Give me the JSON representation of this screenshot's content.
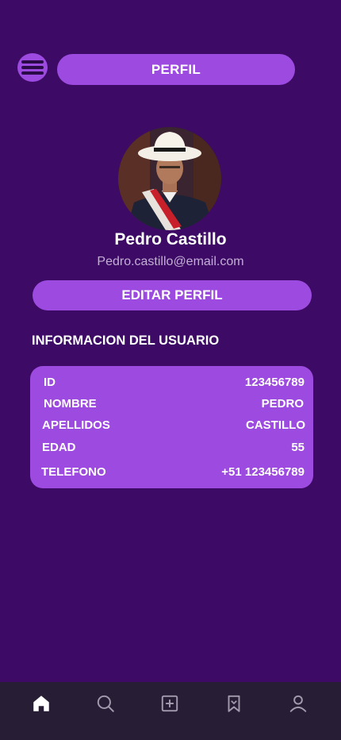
{
  "header": {
    "menu_icon": "hamburger-menu-icon",
    "title": "PERFIL"
  },
  "profile": {
    "name": "Pedro Castillo",
    "email": "Pedro.castillo@email.com",
    "edit_label": "EDITAR PERFIL"
  },
  "info": {
    "section_title": "INFORMACION DEL USUARIO",
    "rows": [
      {
        "label": "ID",
        "value": "123456789"
      },
      {
        "label": "NOMBRE",
        "value": "PEDRO"
      },
      {
        "label": "APELLIDOS",
        "value": "CASTILLO"
      },
      {
        "label": "EDAD",
        "value": "55"
      },
      {
        "label": "TELEFONO",
        "value": "+51 123456789"
      }
    ]
  },
  "nav": {
    "items": [
      {
        "icon": "home-icon",
        "active": true
      },
      {
        "icon": "search-icon",
        "active": false
      },
      {
        "icon": "add-square-icon",
        "active": false
      },
      {
        "icon": "bookmark-icon",
        "active": false
      },
      {
        "icon": "user-icon",
        "active": false
      }
    ]
  },
  "colors": {
    "background": "#3d0b66",
    "accent": "#9d4ae0",
    "nav_background": "#271d35",
    "muted_text": "#c3aed5"
  }
}
